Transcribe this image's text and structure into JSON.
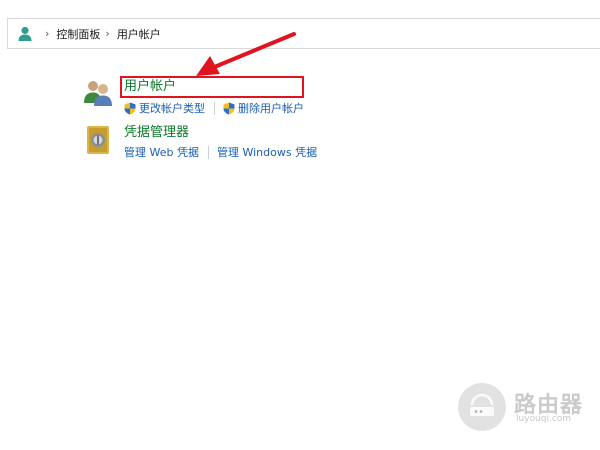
{
  "breadcrumb": {
    "icon": "user-accounts-icon",
    "items": [
      "控制面板",
      "用户帐户"
    ]
  },
  "categories": [
    {
      "icon": "user-accounts-icon",
      "title": "用户帐户",
      "highlighted": true,
      "links": [
        {
          "label": "更改帐户类型",
          "icon": "uac-shield-icon"
        },
        {
          "label": "删除用户帐户",
          "icon": "uac-shield-icon"
        }
      ]
    },
    {
      "icon": "credential-manager-icon",
      "title": "凭据管理器",
      "links": [
        {
          "label": "管理 Web 凭据"
        },
        {
          "label": "管理 Windows 凭据"
        }
      ]
    }
  ],
  "annotation": {
    "type": "red-arrow",
    "color": "#e0141e"
  },
  "watermark": {
    "text": "路由器",
    "subtext": "luyouqi.com"
  },
  "colors": {
    "title_green": "#0a7a2a",
    "link_blue": "#1a5fb4",
    "highlight_red": "#e0141e"
  }
}
